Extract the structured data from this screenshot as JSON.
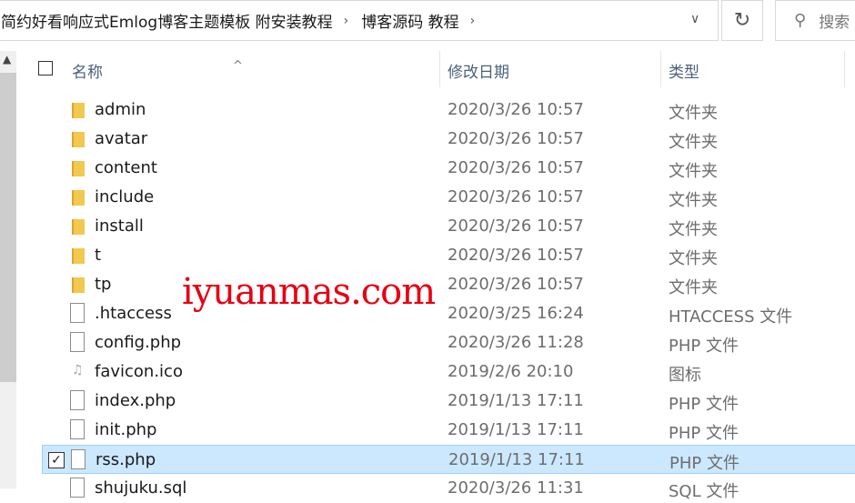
{
  "address": {
    "crumbs": [
      "简约好看响应式Emlog博客主题模板 附安装教程",
      "博客源码 教程"
    ]
  },
  "search": {
    "placeholder": "搜索"
  },
  "columns": {
    "name": "名称",
    "date": "修改日期",
    "type": "类型"
  },
  "watermark": "iyuanmas.com",
  "files": [
    {
      "name": "admin",
      "date": "2020/3/26 10:57",
      "type": "文件夹",
      "icon": "folder"
    },
    {
      "name": "avatar",
      "date": "2020/3/26 10:57",
      "type": "文件夹",
      "icon": "folder"
    },
    {
      "name": "content",
      "date": "2020/3/26 10:57",
      "type": "文件夹",
      "icon": "folder"
    },
    {
      "name": "include",
      "date": "2020/3/26 10:57",
      "type": "文件夹",
      "icon": "folder"
    },
    {
      "name": "install",
      "date": "2020/3/26 10:57",
      "type": "文件夹",
      "icon": "folder"
    },
    {
      "name": "t",
      "date": "2020/3/26 10:57",
      "type": "文件夹",
      "icon": "folder"
    },
    {
      "name": "tp",
      "date": "2020/3/26 10:57",
      "type": "文件夹",
      "icon": "folder"
    },
    {
      "name": ".htaccess",
      "date": "2020/3/25 16:24",
      "type": "HTACCESS 文件",
      "icon": "file"
    },
    {
      "name": "config.php",
      "date": "2020/3/26 11:28",
      "type": "PHP 文件",
      "icon": "file"
    },
    {
      "name": "favicon.ico",
      "date": "2019/2/6 20:10",
      "type": "图标",
      "icon": "image"
    },
    {
      "name": "index.php",
      "date": "2019/1/13 17:11",
      "type": "PHP 文件",
      "icon": "file"
    },
    {
      "name": "init.php",
      "date": "2019/1/13 17:11",
      "type": "PHP 文件",
      "icon": "file"
    },
    {
      "name": "rss.php",
      "date": "2019/1/13 17:11",
      "type": "PHP 文件",
      "icon": "file",
      "selected": true
    },
    {
      "name": "shujuku.sql",
      "date": "2020/3/26 11:31",
      "type": "SQL 文件",
      "icon": "file"
    }
  ]
}
